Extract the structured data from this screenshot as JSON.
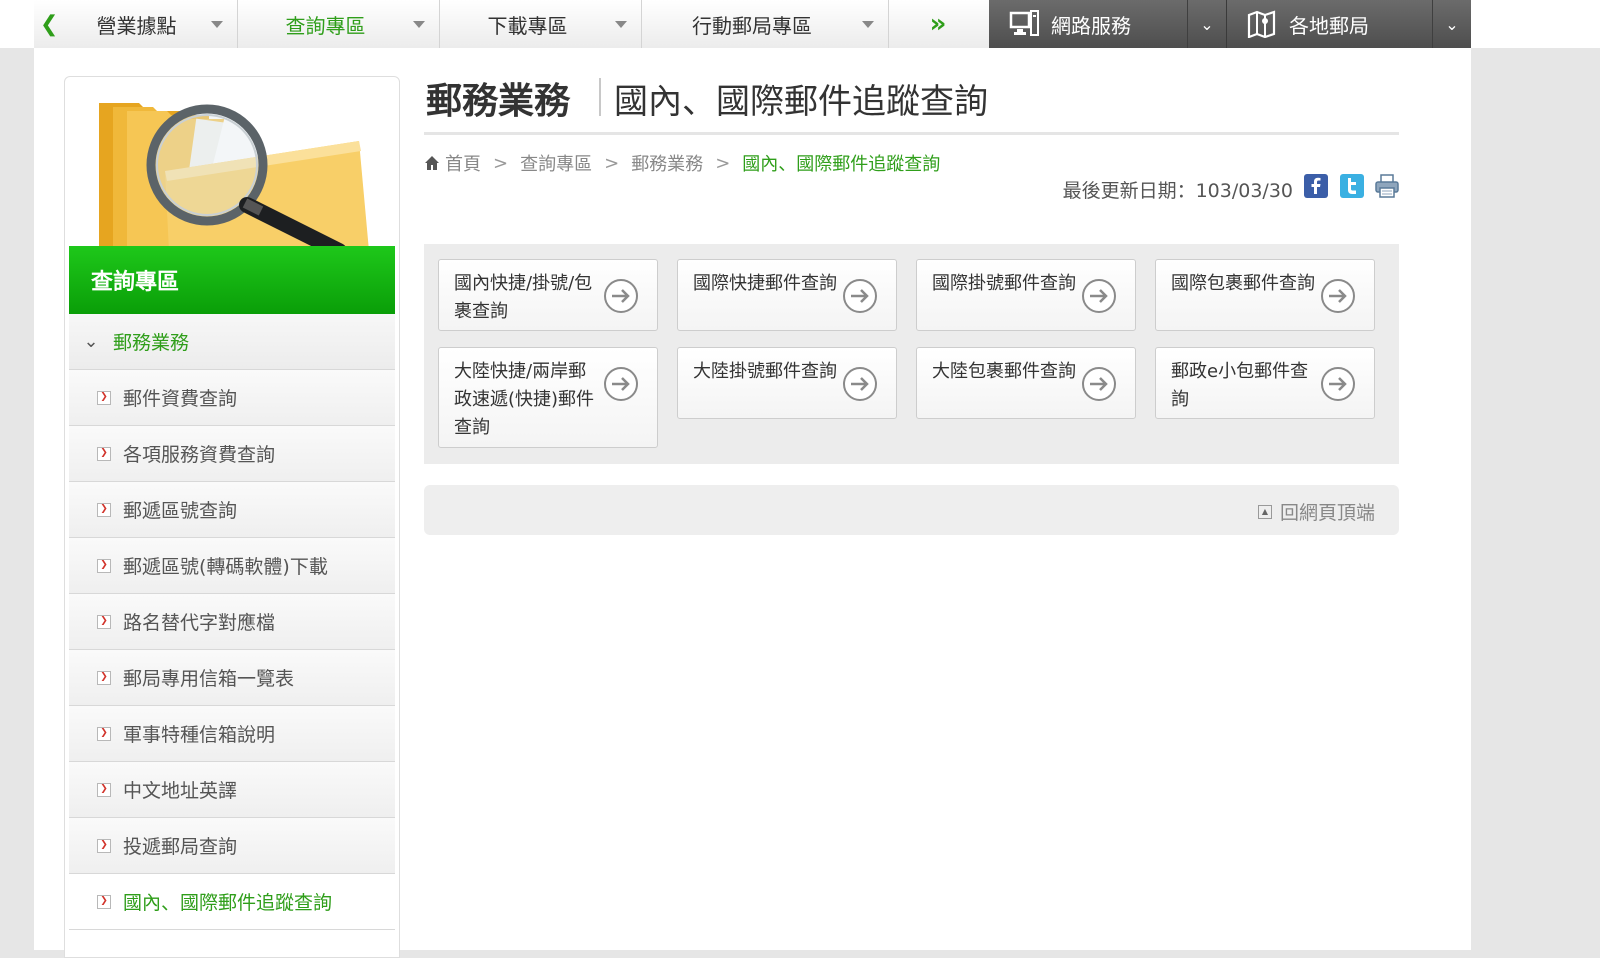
{
  "nav": {
    "items": [
      {
        "label": "營業據點"
      },
      {
        "label": "查詢專區"
      },
      {
        "label": "下載專區"
      },
      {
        "label": "行動郵局專區"
      }
    ],
    "dark": [
      {
        "label": "網路服務"
      },
      {
        "label": "各地郵局"
      }
    ]
  },
  "sidebar": {
    "heading": "查詢專區",
    "section": "郵務業務",
    "items": [
      {
        "label": "郵件資費查詢"
      },
      {
        "label": "各項服務資費查詢"
      },
      {
        "label": "郵遞區號查詢"
      },
      {
        "label": "郵遞區號(轉碼軟體)下載"
      },
      {
        "label": "路名替代字對應檔"
      },
      {
        "label": "郵局專用信箱一覽表"
      },
      {
        "label": "軍事特種信箱說明"
      },
      {
        "label": "中文地址英譯"
      },
      {
        "label": "投遞郵局查詢"
      },
      {
        "label": "國內、國際郵件追蹤查詢"
      }
    ]
  },
  "title": {
    "section": "郵務業務",
    "page": "國內、國際郵件追蹤查詢"
  },
  "breadcrumb": {
    "home": "首頁",
    "level1": "查詢專區",
    "level2": "郵務業務",
    "current": "國內、國際郵件追蹤查詢"
  },
  "updated": "最後更新日期：103/03/30",
  "cards": [
    {
      "label": "國內快捷/掛號/包裹查詢"
    },
    {
      "label": "國際快捷郵件查詢"
    },
    {
      "label": "國際掛號郵件查詢"
    },
    {
      "label": "國際包裹郵件查詢"
    },
    {
      "label": "大陸快捷/兩岸郵政速遞(快捷)郵件查詢"
    },
    {
      "label": "大陸掛號郵件查詢"
    },
    {
      "label": "大陸包裹郵件查詢"
    },
    {
      "label": "郵政e小包郵件查詢"
    }
  ],
  "backtop": "回網頁頂端",
  "colors": {
    "accent": "#2f9e1a",
    "sidebar_head": "#12b210"
  }
}
